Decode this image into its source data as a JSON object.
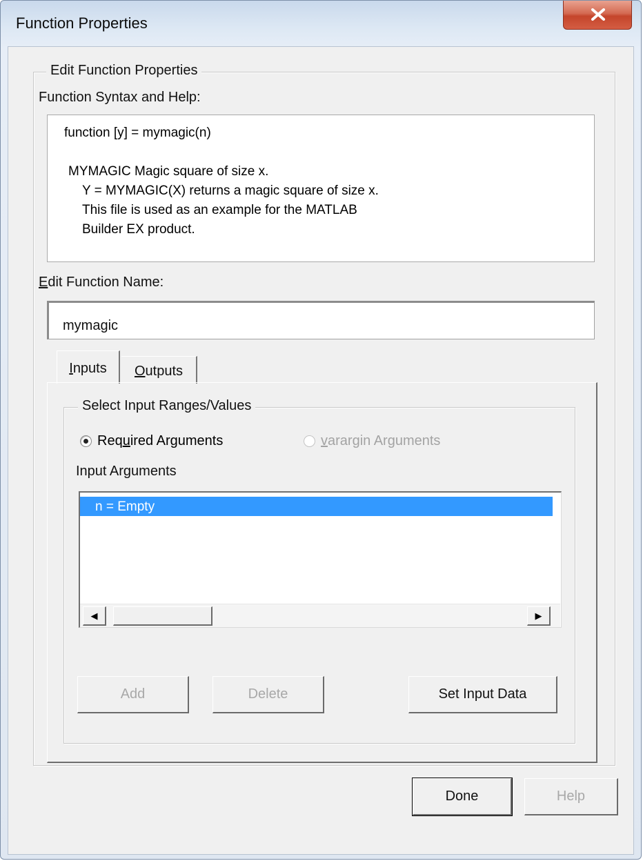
{
  "window": {
    "title": "Function Properties"
  },
  "group": {
    "label": "Edit Function Properties",
    "syntax_label": "Function Syntax and Help:",
    "help_lines": [
      "function [y] = mymagic(n)",
      "MYMAGIC Magic square of size x.",
      "Y = MYMAGIC(X) returns a magic square of size x.",
      "This file is used as an example for the MATLAB",
      "Builder EX product."
    ],
    "name_label": "Edit Function Name:",
    "name_value": "mymagic"
  },
  "tabs": {
    "inputs": "Inputs",
    "outputs": "Outputs",
    "active": "Inputs"
  },
  "inputs_panel": {
    "group_label": "Select Input Ranges/Values",
    "radio_required": "Required Arguments",
    "radio_required_checked": true,
    "radio_varargin": "varargin Arguments",
    "radio_varargin_enabled": false,
    "list_label": "Input Arguments",
    "list_items": [
      "n = Empty"
    ],
    "selected_index": 0,
    "buttons": {
      "add": "Add",
      "delete": "Delete",
      "set_input": "Set Input Data"
    }
  },
  "footer": {
    "done": "Done",
    "help": "Help"
  },
  "colors": {
    "selection": "#3399ff",
    "close_button": "#c94c33",
    "disabled_text": "#a8a8a8"
  }
}
